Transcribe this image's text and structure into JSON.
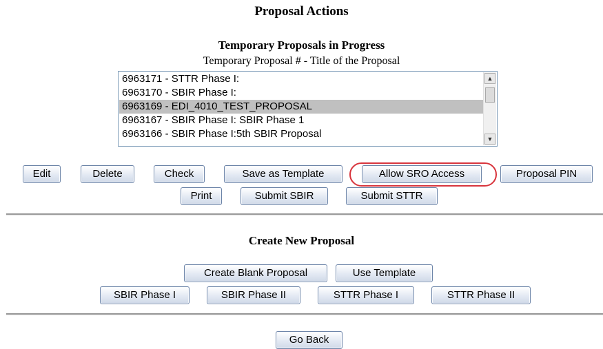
{
  "page": {
    "title": "Proposal Actions"
  },
  "temporary": {
    "heading": "Temporary Proposals in Progress",
    "column_header": "Temporary Proposal # - Title of the Proposal",
    "items": [
      "6963171 - STTR Phase I:",
      "6963170 - SBIR Phase I:",
      "6963169 - EDI_4010_TEST_PROPOSAL",
      "6963167 - SBIR Phase I: SBIR Phase 1",
      "6963166 - SBIR Phase I:5th SBIR Proposal"
    ],
    "selected_item": "6963169 - EDI_4010_TEST_PROPOSAL"
  },
  "actions": {
    "edit": "Edit",
    "delete": "Delete",
    "check": "Check",
    "save_as_template": "Save as Template",
    "allow_sro_access": "Allow SRO Access",
    "proposal_pin": "Proposal PIN",
    "print": "Print",
    "submit_sbir": "Submit SBIR",
    "submit_sttr": "Submit STTR"
  },
  "highlight": {
    "color": "#d8343c",
    "target": "Allow SRO Access"
  },
  "create": {
    "heading": "Create New Proposal",
    "create_blank": "Create Blank Proposal",
    "use_template": "Use Template",
    "sbir_phase_1": "SBIR Phase I",
    "sbir_phase_2": "SBIR Phase II",
    "sttr_phase_1": "STTR Phase I",
    "sttr_phase_2": "STTR Phase II"
  },
  "footer": {
    "go_back": "Go Back"
  },
  "icons": {
    "scroll_up": "scroll-up-arrow-icon",
    "scroll_down": "scroll-down-arrow-icon"
  },
  "colors": {
    "selected_row": "#c0c0c0",
    "button_border": "#6c84a8",
    "rule": "#9a9a9a"
  }
}
